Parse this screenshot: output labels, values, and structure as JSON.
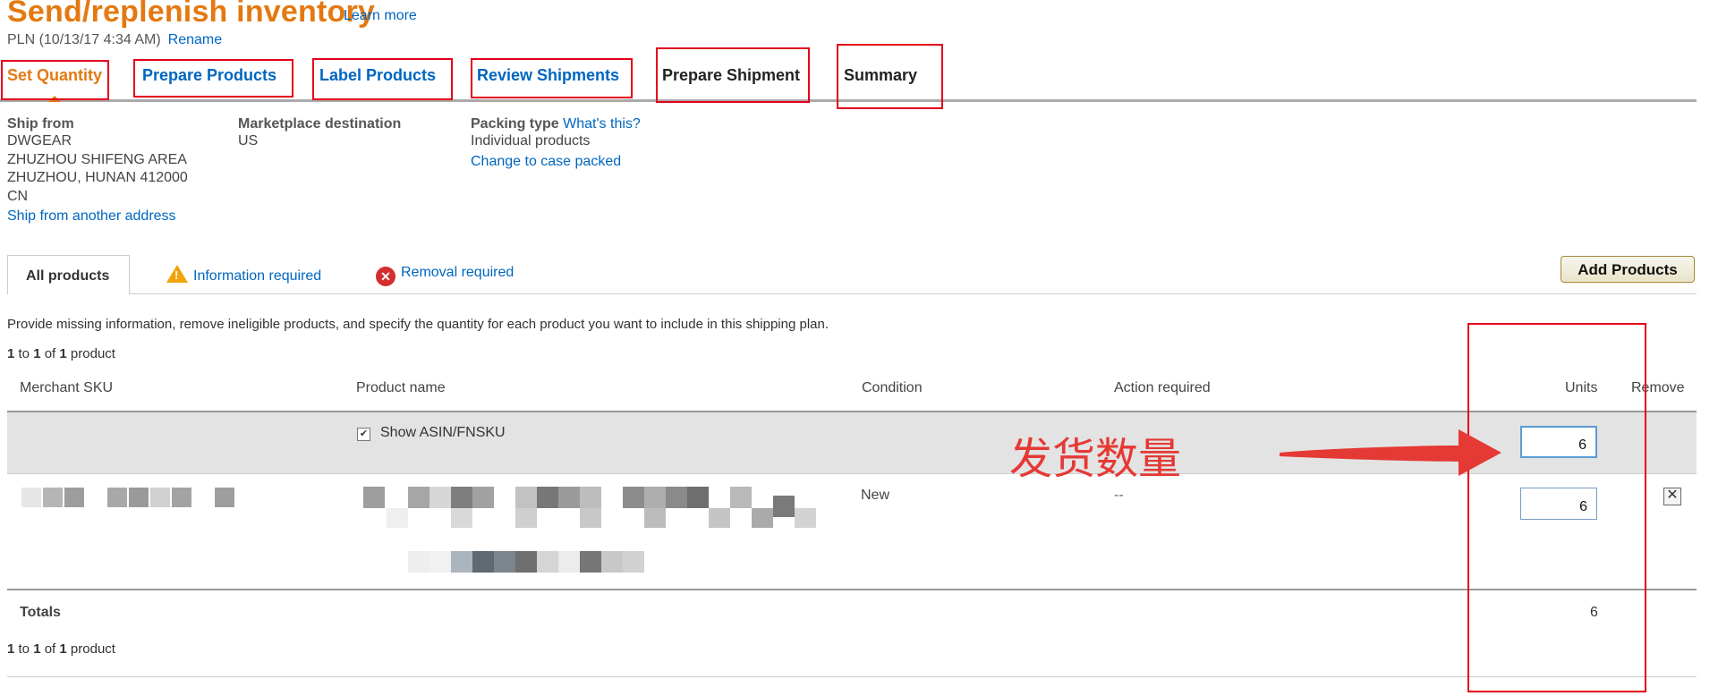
{
  "header": {
    "title": "Send/replenish inventory",
    "learn_more": "Learn more",
    "plan_name": "PLN (10/13/17 4:34 AM)",
    "rename": "Rename"
  },
  "steps": [
    {
      "label": "Set Quantity",
      "state": "active"
    },
    {
      "label": "Prepare Products",
      "state": "done"
    },
    {
      "label": "Label Products",
      "state": "done"
    },
    {
      "label": "Review Shipments",
      "state": "done"
    },
    {
      "label": "Prepare Shipment",
      "state": "todo"
    },
    {
      "label": "Summary",
      "state": "todo"
    }
  ],
  "ship_from": {
    "label": "Ship from",
    "lines": [
      "DWGEAR",
      "ZHUZHOU SHIFENG AREA",
      "ZHUZHOU, HUNAN 412000",
      "CN"
    ],
    "link": "Ship from another address"
  },
  "marketplace": {
    "label": "Marketplace destination",
    "value": "US"
  },
  "packing": {
    "label": "Packing type",
    "help_link": "What's this?",
    "value": "Individual products",
    "change_link": "Change to case packed"
  },
  "tabs": {
    "all": "All products",
    "info": "Information required",
    "removal": "Removal required"
  },
  "add_products": "Add Products",
  "instructions": "Provide missing information, remove ineligible products, and specify the quantity for each product you want to include in this shipping plan.",
  "pagination": {
    "from": "1",
    "to_word": "to",
    "to": "1",
    "of_word": "of",
    "total": "1",
    "unit": "product"
  },
  "table": {
    "headers": {
      "sku": "Merchant SKU",
      "name": "Product name",
      "condition": "Condition",
      "action": "Action required",
      "units": "Units",
      "remove": "Remove"
    },
    "show_asin": "Show ASIN/FNSKU",
    "apply_all_units": "6",
    "row": {
      "condition": "New",
      "action": "--",
      "units": "6"
    },
    "totals_label": "Totals",
    "totals_value": "6"
  },
  "annotation": {
    "text": "发货数量",
    "color": "#e53935"
  },
  "colors": {
    "brand_orange": "#e47911",
    "link_blue": "#0066c0",
    "annotation_red": "#e4001b"
  }
}
